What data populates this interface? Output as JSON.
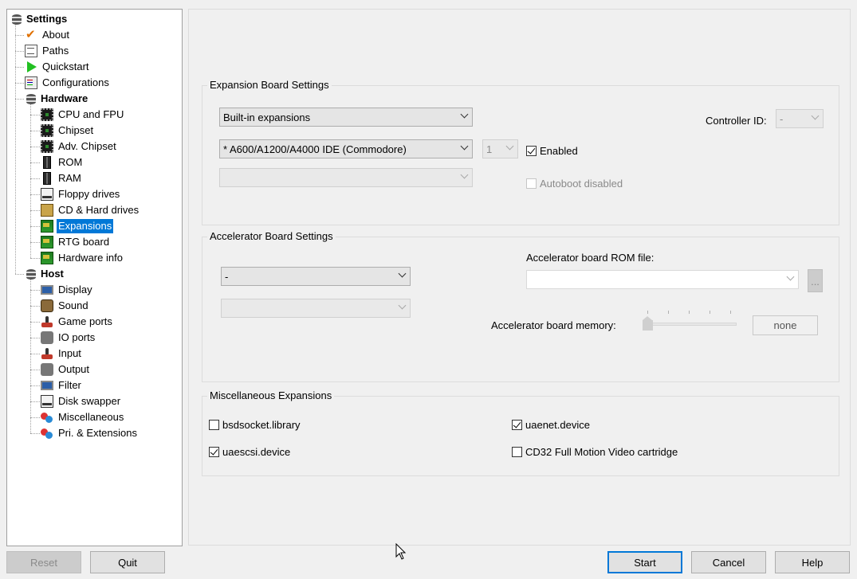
{
  "tree": {
    "items": [
      {
        "label": "Settings",
        "icon": "database-icon",
        "level": 0,
        "bold": true
      },
      {
        "label": "About",
        "icon": "checkmark-icon",
        "level": 1
      },
      {
        "label": "Paths",
        "icon": "document-icon",
        "level": 1
      },
      {
        "label": "Quickstart",
        "icon": "play-icon",
        "level": 1
      },
      {
        "label": "Configurations",
        "icon": "config-list-icon",
        "level": 1
      },
      {
        "label": "Hardware",
        "icon": "database-icon",
        "level": 1,
        "bold": true
      },
      {
        "label": "CPU and FPU",
        "icon": "chip-icon",
        "level": 2
      },
      {
        "label": "Chipset",
        "icon": "chip-icon",
        "level": 2
      },
      {
        "label": "Adv. Chipset",
        "icon": "chip-icon",
        "level": 2
      },
      {
        "label": "ROM",
        "icon": "memory-stick-icon",
        "level": 2
      },
      {
        "label": "RAM",
        "icon": "memory-stick-icon",
        "level": 2
      },
      {
        "label": "Floppy drives",
        "icon": "floppy-icon",
        "level": 2
      },
      {
        "label": "CD & Hard drives",
        "icon": "hard-drive-icon",
        "level": 2
      },
      {
        "label": "Expansions",
        "icon": "expansion-card-icon",
        "level": 2,
        "selected": true
      },
      {
        "label": "RTG board",
        "icon": "expansion-card-icon",
        "level": 2
      },
      {
        "label": "Hardware info",
        "icon": "expansion-card-icon",
        "level": 2
      },
      {
        "label": "Host",
        "icon": "database-icon",
        "level": 1,
        "bold": true
      },
      {
        "label": "Display",
        "icon": "monitor-icon",
        "level": 2
      },
      {
        "label": "Sound",
        "icon": "speaker-icon",
        "level": 2
      },
      {
        "label": "Game ports",
        "icon": "joystick-icon",
        "level": 2
      },
      {
        "label": "IO ports",
        "icon": "plug-icon",
        "level": 2
      },
      {
        "label": "Input",
        "icon": "joystick-icon",
        "level": 2
      },
      {
        "label": "Output",
        "icon": "plug-icon",
        "level": 2
      },
      {
        "label": "Filter",
        "icon": "monitor-icon",
        "level": 2
      },
      {
        "label": "Disk swapper",
        "icon": "floppy-icon",
        "level": 2
      },
      {
        "label": "Miscellaneous",
        "icon": "gears-icon",
        "level": 2
      },
      {
        "label": "Pri. & Extensions",
        "icon": "gears-icon",
        "level": 2
      }
    ]
  },
  "expansion": {
    "title": "Expansion Board Settings",
    "category_value": "Built-in expansions",
    "board_value": "* A600/A1200/A4000 IDE (Commodore)",
    "unit_value": "1",
    "third_value": "",
    "enabled_label": "Enabled",
    "enabled_checked": true,
    "autoboot_label": "Autoboot disabled",
    "autoboot_checked": false,
    "controller_id_label": "Controller ID:",
    "controller_id_value": "-"
  },
  "accelerator": {
    "title": "Accelerator Board Settings",
    "board_value": "-",
    "second_value": "",
    "rom_file_label": "Accelerator board ROM file:",
    "rom_file_value": "",
    "browse_label": "...",
    "memory_label": "Accelerator board memory:",
    "memory_value": "none",
    "memory_level": 0
  },
  "misc": {
    "title": "Miscellaneous Expansions",
    "bsdsocket_label": "bsdsocket.library",
    "bsdsocket_checked": false,
    "uaescsi_label": "uaescsi.device",
    "uaescsi_checked": true,
    "uaenet_label": "uaenet.device",
    "uaenet_checked": true,
    "cd32fmv_label": "CD32 Full Motion Video cartridge",
    "cd32fmv_checked": false
  },
  "buttons": {
    "reset": "Reset",
    "quit": "Quit",
    "start": "Start",
    "cancel": "Cancel",
    "help": "Help"
  },
  "colors": {
    "selection": "#0078d7",
    "default_button_border": "#0078d7"
  }
}
